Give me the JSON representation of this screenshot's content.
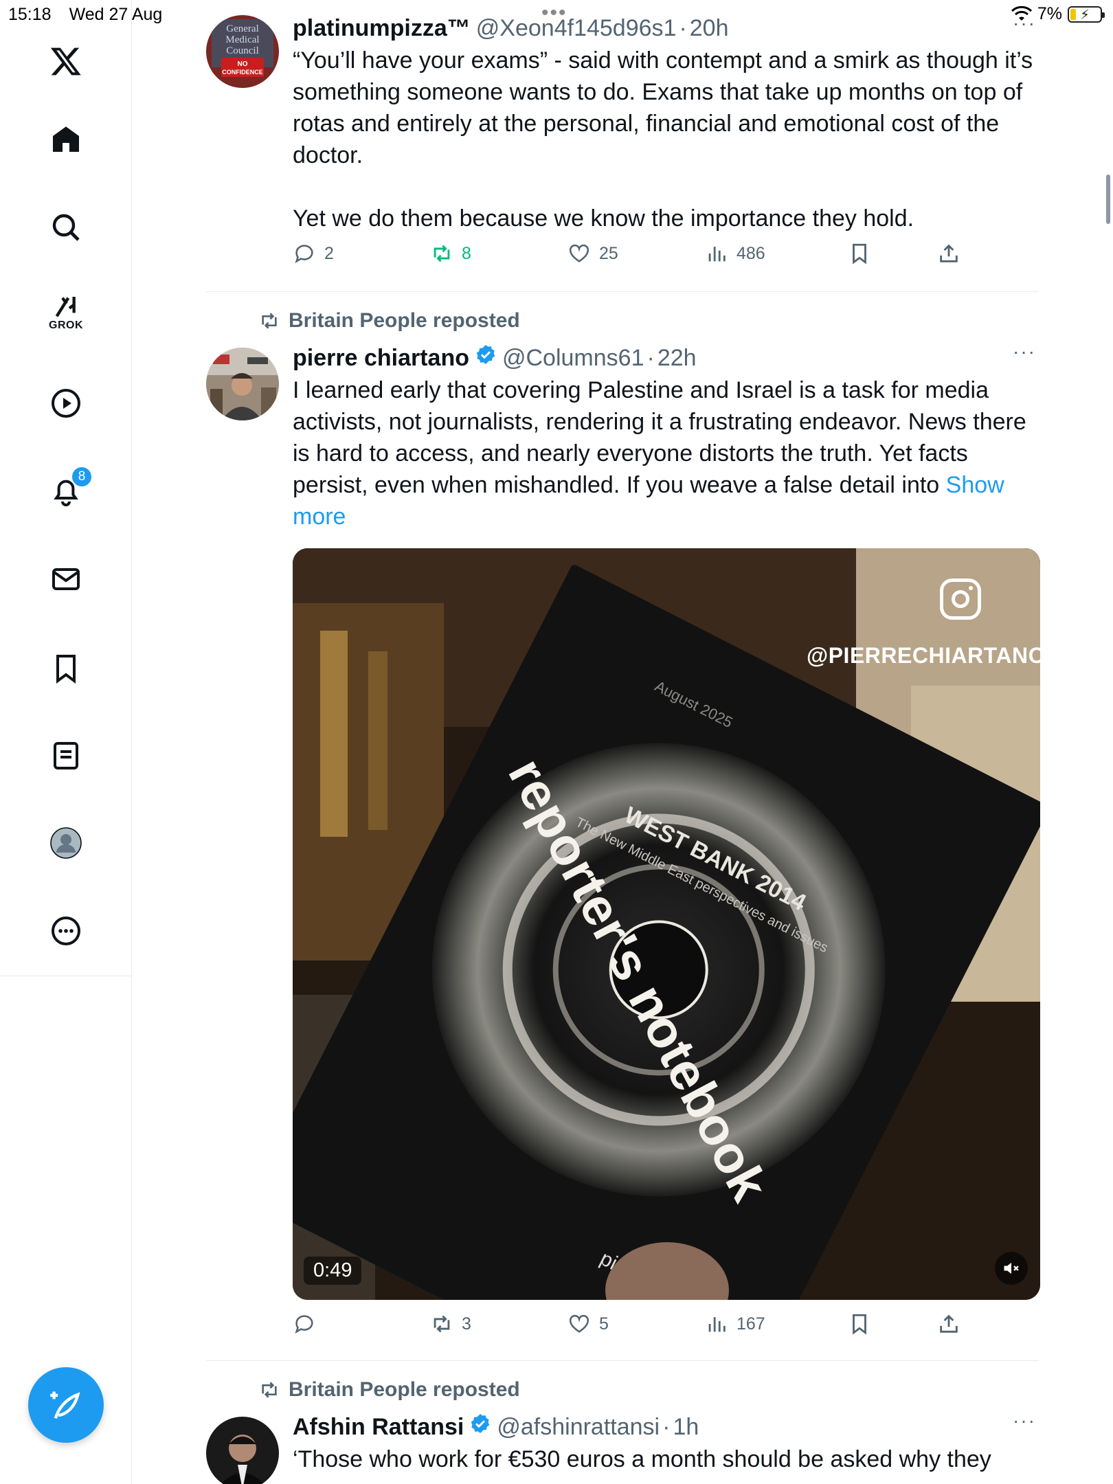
{
  "status_bar": {
    "time": "15:18",
    "date": "Wed 27 Aug",
    "battery": "7%"
  },
  "sidebar": {
    "grok_label": "GROK",
    "notifications_badge": "8"
  },
  "tweets": [
    {
      "name": "platinumpizza™",
      "handle": "@Xeon4f145d96s1",
      "time": "20h",
      "text": "“You’ll have your exams” - said with contempt and a smirk as though it’s something someone wants to do. Exams that take up months on top of rotas and entirely at the personal, financial and emotional cost of the doctor.\n\nYet we do them because we know the importance they hold.",
      "avatar_text": [
        "General",
        "Medical",
        "Council",
        "NO",
        "CONFIDENCE"
      ],
      "replies": "2",
      "reposts": "8",
      "likes": "25",
      "views": "486"
    },
    {
      "reposted_by": "Britain People reposted",
      "name": "pierre chiartano",
      "handle": "@Columns61",
      "time": "22h",
      "text": "I learned early that covering Palestine and Israel is a task for media activists, not journalists, rendering it a frustrating endeavor. News there is hard to access, and nearly everyone distorts the truth. Yet facts persist, even when mishandled. If you weave a false detail into ",
      "show_more": "Show more",
      "media": {
        "duration": "0:49",
        "ig_handle": "@PIERRECHIARTANO",
        "book_title": "reporter's notebook",
        "book_subtitle": "WEST BANK 2014",
        "book_tagline": "The New Middle East perspectives and issues",
        "book_date": "August 2025",
        "book_author": "pierre chiartano"
      },
      "replies": "",
      "reposts": "3",
      "likes": "5",
      "views": "167"
    },
    {
      "reposted_by": "Britain People reposted",
      "name": "Afshin Rattansi",
      "handle": "@afshinrattansi",
      "time": "1h",
      "text": "‘Those who work for €530 euros a month should be asked why they"
    }
  ],
  "colors": {
    "accent": "#1d9bf0",
    "secondary_text": "#536471",
    "repost_green": "#00ba7c"
  }
}
